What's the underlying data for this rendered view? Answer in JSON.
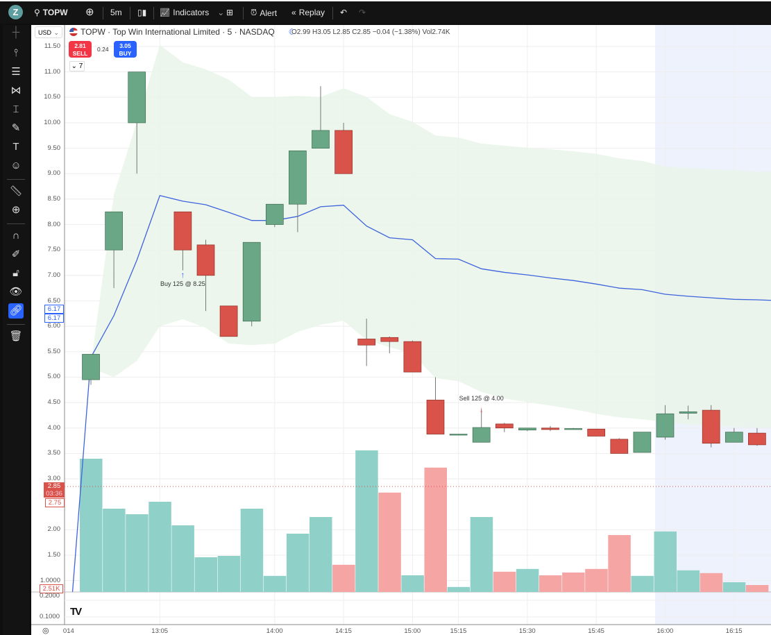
{
  "topbar": {
    "symbol": "TOPW",
    "logo": "Z",
    "interval": "5m",
    "indicators": "Indicators",
    "alert": "Alert",
    "replay": "Replay"
  },
  "legend": {
    "title": "TOPW · Top Win International Limited · 5 · NASDAQ",
    "ohlc": "O2.99 H3.05 L2.85 C2.85 −0.04 (−1.38%) Vol2.74K",
    "currency": "USD"
  },
  "trade": {
    "sell_price": "2.81",
    "sell_label": "SELL",
    "spread": "0.24",
    "buy_price": "3.05",
    "buy_label": "BUY",
    "collapse": "7"
  },
  "price_axis": [
    "11.50",
    "11.00",
    "10.50",
    "10.00",
    "9.50",
    "9.00",
    "8.50",
    "8.00",
    "7.50",
    "7.00",
    "6.50",
    "6.00",
    "5.50",
    "5.00",
    "4.50",
    "4.00",
    "3.50",
    "3.00",
    "2.00",
    "1.50",
    "1.0000"
  ],
  "sub_axis": [
    "0.2000",
    "0.1000"
  ],
  "tags": {
    "vwap1": "6.17",
    "vwap2": "6.17",
    "last": "2.85",
    "countdown": "03:36",
    "low": "2.75",
    "volume": "2.51K"
  },
  "time_axis": [
    {
      "i": -1.15,
      "t": "014"
    },
    {
      "i": 3,
      "t": "13:05"
    },
    {
      "i": 8,
      "t": "14:00"
    },
    {
      "i": 11,
      "t": "14:15"
    },
    {
      "i": 14,
      "t": "15:00"
    },
    {
      "i": 16,
      "t": "15:15"
    },
    {
      "i": 19,
      "t": "15:30"
    },
    {
      "i": 22,
      "t": "15:45"
    },
    {
      "i": 25,
      "t": "16:00"
    },
    {
      "i": 28,
      "t": "16:15"
    }
  ],
  "annotations": [
    {
      "i": 4,
      "text": "Buy 125 @ 8.25",
      "side": "buy",
      "price": 7.0
    },
    {
      "i": 17,
      "text": "Sell 125 @ 4.00",
      "side": "sell",
      "price": 4.45
    }
  ],
  "colors": {
    "up": "#6aa786",
    "down": "#d9534a",
    "vol_up": "#8fd1c8",
    "vol_down": "#f5a5a3",
    "vwap": "#3d63dd",
    "band": "#e9f5e9",
    "ext": "#eef2fd"
  },
  "chart_data": {
    "type": "candlestick",
    "ylim": [
      0.9,
      11.6
    ],
    "ohlc": [
      [
        4.95,
        5.45,
        4.85,
        5.45
      ],
      [
        7.5,
        8.25,
        6.75,
        8.25
      ],
      [
        10.0,
        11.0,
        9.0,
        11.0
      ],
      null,
      [
        8.25,
        8.25,
        7.1,
        7.5
      ],
      [
        7.6,
        7.7,
        6.3,
        7.0
      ],
      [
        6.4,
        6.4,
        5.8,
        5.8
      ],
      [
        6.1,
        7.65,
        6.0,
        7.65
      ],
      [
        8.0,
        8.4,
        7.95,
        8.4
      ],
      [
        8.4,
        9.45,
        7.85,
        9.45
      ],
      [
        9.5,
        10.72,
        9.5,
        9.85
      ],
      [
        9.85,
        10.0,
        9.0,
        9.0
      ],
      [
        5.75,
        6.15,
        5.22,
        5.63
      ],
      [
        5.78,
        5.8,
        5.47,
        5.7
      ],
      [
        5.7,
        5.72,
        5.1,
        5.1
      ],
      [
        4.55,
        5.0,
        3.88,
        3.88
      ],
      [
        3.88,
        3.88,
        3.88,
        3.88
      ],
      [
        3.72,
        4.37,
        3.72,
        4.01
      ],
      [
        4.08,
        4.1,
        3.92,
        4.0
      ],
      [
        3.96,
        4.0,
        3.94,
        4.0
      ],
      [
        4.0,
        4.04,
        3.94,
        3.97
      ],
      [
        3.98,
        4.0,
        3.97,
        3.99
      ],
      [
        3.98,
        3.98,
        3.84,
        3.84
      ],
      [
        3.78,
        3.8,
        3.5,
        3.5
      ],
      [
        3.52,
        3.92,
        3.52,
        3.92
      ],
      [
        3.82,
        4.45,
        3.77,
        4.28
      ],
      [
        4.29,
        4.44,
        4.17,
        4.32
      ],
      [
        4.35,
        4.45,
        3.62,
        3.7
      ],
      [
        3.72,
        4.0,
        3.72,
        3.92
      ],
      [
        3.9,
        4.0,
        3.65,
        3.67
      ]
    ],
    "volume_k": [
      48,
      30,
      28,
      32.5,
      24,
      12.5,
      13,
      30,
      5.8,
      21,
      27,
      9.8,
      51,
      35.8,
      6,
      44.8,
      1.8,
      27,
      7.3,
      8.3,
      6,
      7,
      8.3,
      20.5,
      5.8,
      21.8,
      7.8,
      6.8,
      3.5,
      2.5
    ],
    "volume_up": [
      1,
      1,
      1,
      1,
      1,
      1,
      1,
      1,
      1,
      1,
      1,
      0,
      1,
      0,
      1,
      0,
      1,
      1,
      0,
      1,
      0,
      0,
      0,
      0,
      1,
      1,
      1,
      0,
      1,
      0
    ],
    "vwap_start": 0.78,
    "vwap": [
      5.39,
      6.21,
      7.3,
      8.57,
      8.46,
      8.39,
      8.24,
      8.08,
      8.08,
      8.16,
      8.35,
      8.38,
      7.97,
      7.74,
      7.7,
      7.33,
      7.32,
      7.13,
      7.06,
      7.01,
      6.95,
      6.9,
      6.83,
      6.75,
      6.72,
      6.63,
      6.59,
      6.56,
      6.53,
      6.52
    ],
    "band_upper": [
      5.25,
      8.59,
      10.02,
      11.53,
      11.19,
      11.05,
      10.85,
      10.51,
      10.51,
      10.53,
      10.51,
      10.68,
      10.51,
      10.17,
      10.02,
      9.75,
      9.71,
      9.59,
      9.55,
      9.51,
      9.48,
      9.44,
      9.39,
      9.3,
      9.25,
      9.14,
      9.11,
      9.09,
      9.07,
      9.04
    ],
    "band_lower": [
      5.18,
      5.0,
      5.32,
      6.0,
      6.14,
      5.97,
      5.66,
      5.63,
      5.66,
      5.89,
      6.03,
      6.11,
      5.73,
      5.59,
      5.46,
      4.98,
      4.92,
      4.71,
      4.58,
      4.51,
      4.44,
      4.37,
      4.28,
      4.21,
      4.17,
      4.12,
      4.07,
      4.04,
      4.02,
      4.01
    ],
    "last_price": 2.85,
    "extended_from_index": 24.5
  }
}
